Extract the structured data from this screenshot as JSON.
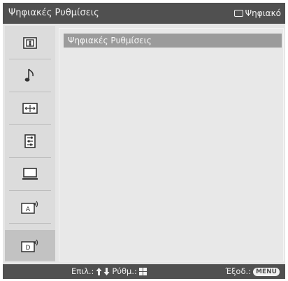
{
  "header": {
    "title": "Ψηφιακές Ρυθμίσεις",
    "input_label": "Ψηφιακό",
    "input_icon": "tv-input-icon"
  },
  "sidebar": {
    "items": [
      {
        "name": "picture-settings",
        "icon": "picture-icon"
      },
      {
        "name": "sound-settings",
        "icon": "music-note-icon"
      },
      {
        "name": "screen-settings",
        "icon": "screen-control-icon"
      },
      {
        "name": "setup",
        "icon": "setup-list-icon"
      },
      {
        "name": "pc-settings",
        "icon": "pc-monitor-icon"
      },
      {
        "name": "analog-settings",
        "icon": "analog-antenna-icon"
      },
      {
        "name": "digital-settings",
        "icon": "digital-antenna-icon",
        "selected": true
      }
    ]
  },
  "main": {
    "menu_items": [
      "Ψηφιακές Ρυθμίσεις"
    ]
  },
  "footer": {
    "select_label": "Επιλ.:",
    "adjust_label": "Ρύθμ.:",
    "exit_label": "Έξοδ.:",
    "menu_key": "MENU"
  },
  "colors": {
    "bar": "#505050",
    "background": "#e6e6e6",
    "highlight": "#9b9b9b",
    "selected_tab": "#c2c2c2"
  }
}
